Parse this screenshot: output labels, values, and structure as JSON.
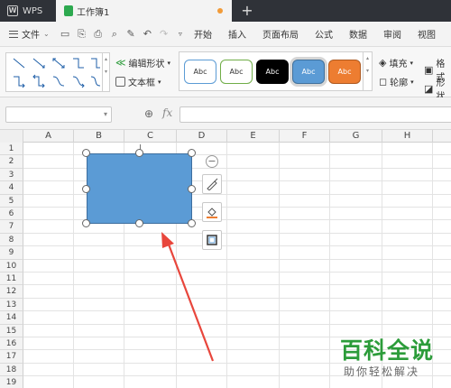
{
  "titlebar": {
    "app_name": "WPS",
    "doc_tab": "工作簿1",
    "new_tab": "+"
  },
  "menubar": {
    "file": "文件",
    "items": [
      "开始",
      "插入",
      "页面布局",
      "公式",
      "数据",
      "审阅",
      "视图"
    ]
  },
  "ribbon": {
    "edit_shape": "编辑形状",
    "textbox": "文本框",
    "styles": [
      {
        "label": "Abc",
        "fill": "#ffffff",
        "border": "#5b9bd5",
        "text": "#333333"
      },
      {
        "label": "Abc",
        "fill": "#ffffff",
        "border": "#70ad47",
        "text": "#333333"
      },
      {
        "label": "Abc",
        "fill": "#000000",
        "border": "#000000",
        "text": "#ffffff"
      },
      {
        "label": "Abc",
        "fill": "#5b9bd5",
        "border": "#41719c",
        "text": "#ffffff"
      },
      {
        "label": "Abc",
        "fill": "#ed7d31",
        "border": "#ae5a21",
        "text": "#ffffff"
      }
    ],
    "fill": "填充",
    "outline": "轮廓",
    "format": "格式",
    "shape_effect": "形状"
  },
  "formulabar": {
    "fx": "fx"
  },
  "grid": {
    "columns": [
      "A",
      "B",
      "C",
      "D",
      "E",
      "F",
      "G",
      "H"
    ],
    "rows": [
      "1",
      "2",
      "3",
      "4",
      "5",
      "6",
      "7",
      "8",
      "9",
      "10",
      "11",
      "12",
      "13",
      "14",
      "15",
      "16",
      "17",
      "18",
      "19"
    ]
  },
  "shape": {
    "fill_color": "#5b9bd5"
  },
  "watermark": {
    "title": "百科全说",
    "subtitle": "助你轻松解决"
  },
  "colors": {
    "titlebar": "#2f3238",
    "annotation_arrow": "#e8463c",
    "watermark": "#2c9c3a"
  }
}
